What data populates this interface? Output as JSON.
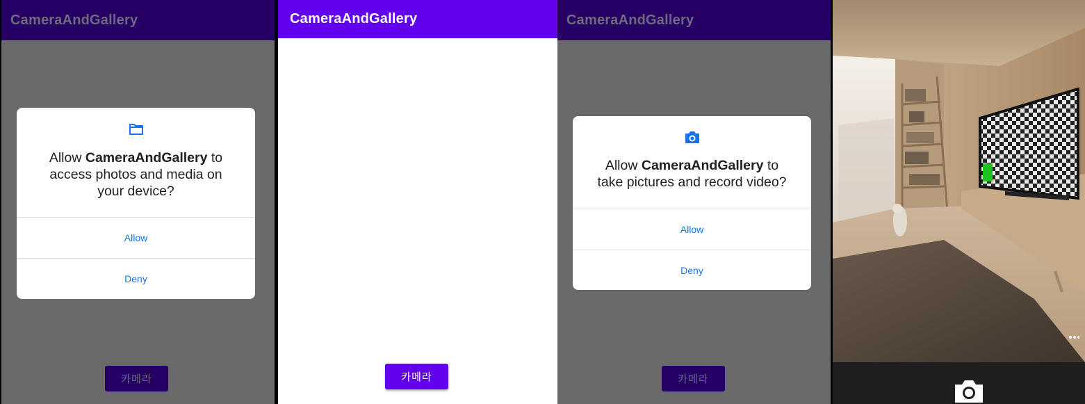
{
  "app_title": "CameraAndGallery",
  "camera_button_label": "카메라",
  "storage_dialog": {
    "icon": "folder-icon",
    "prefix": "Allow ",
    "app_name": "CameraAndGallery",
    "line_suffix": " to",
    "line2": "access photos and media on",
    "line3": "your device?",
    "allow_label": "Allow",
    "deny_label": "Deny"
  },
  "camera_dialog": {
    "icon": "camera-icon",
    "prefix": "Allow ",
    "app_name": "CameraAndGallery",
    "line_suffix": " to",
    "line2": "take pictures and record video?",
    "allow_label": "Allow",
    "deny_label": "Deny"
  },
  "camera_preview": {
    "shutter_icon": "camera-shutter-icon",
    "more_icon": "more-options-icon"
  },
  "colors": {
    "primary": "#6200ee",
    "primary_dimmed": "#260065",
    "scrim": "#6a6a6a",
    "dialog_button": "#1a73e8"
  }
}
